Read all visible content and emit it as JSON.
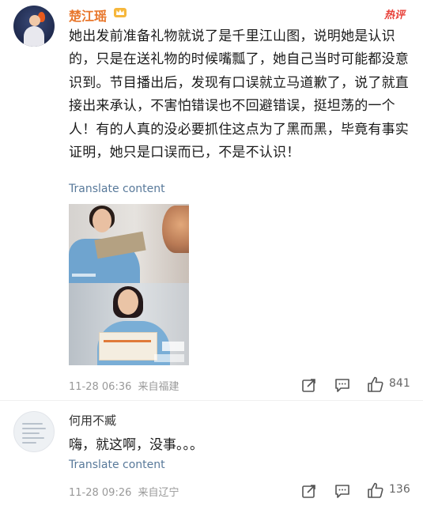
{
  "comment1": {
    "username": "楚江瑶",
    "hot_label": "热评",
    "text": "她出发前准备礼物就说了是千里江山图，说明她是认识的，只是在送礼物的时候嘴瓢了，她自己当时可能都没意识到。节目播出后，发现有口误就立马道歉了，说了就直接出来承认，不害怕错误也不回避错误，挺坦荡的一个人！有的人真的没必要抓住这点为了黑而黑，毕竟有事实证明，她只是口误而已，不是不认识！",
    "translate_label": "Translate content",
    "timestamp": "11-28 06:36",
    "location": "来自福建",
    "like_count": "841"
  },
  "comment2": {
    "username": "何用不臧",
    "text": "嗨，就这啊，没事。。。",
    "translate_label": "Translate content",
    "timestamp": "11-28 09:26",
    "location": "来自辽宁",
    "like_count": "136"
  },
  "icons": {
    "repost": "repost-icon",
    "comment": "comment-icon",
    "like": "thumbs-up-icon",
    "crown": "crown-icon"
  },
  "colors": {
    "username_vip": "#e8762b",
    "hot_tag": "#e8413a",
    "link": "#58799a",
    "meta": "#999999"
  }
}
